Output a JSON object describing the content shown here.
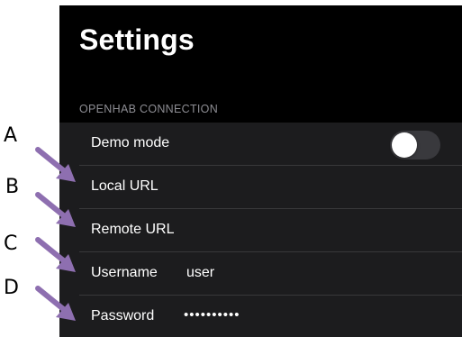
{
  "header": {
    "title": "Settings"
  },
  "section": {
    "header": "OPENHAB CONNECTION"
  },
  "rows": [
    {
      "label": "Demo mode",
      "control": "toggle",
      "toggle_on": false
    },
    {
      "label": "Local URL",
      "value": ""
    },
    {
      "label": "Remote URL",
      "value": ""
    },
    {
      "label": "Username",
      "value": "user"
    },
    {
      "label": "Password",
      "value": "••••••••••"
    }
  ],
  "callouts": [
    "A",
    "B",
    "C",
    "D"
  ],
  "colors": {
    "background": "#000000",
    "group": "#1c1c1e",
    "separator": "#38383a",
    "section_text": "#8d8d93",
    "toggle_off": "#39393d",
    "arrow": "#8e6fb0"
  },
  "icons": {
    "arrow": "purple-arrow-icon"
  }
}
